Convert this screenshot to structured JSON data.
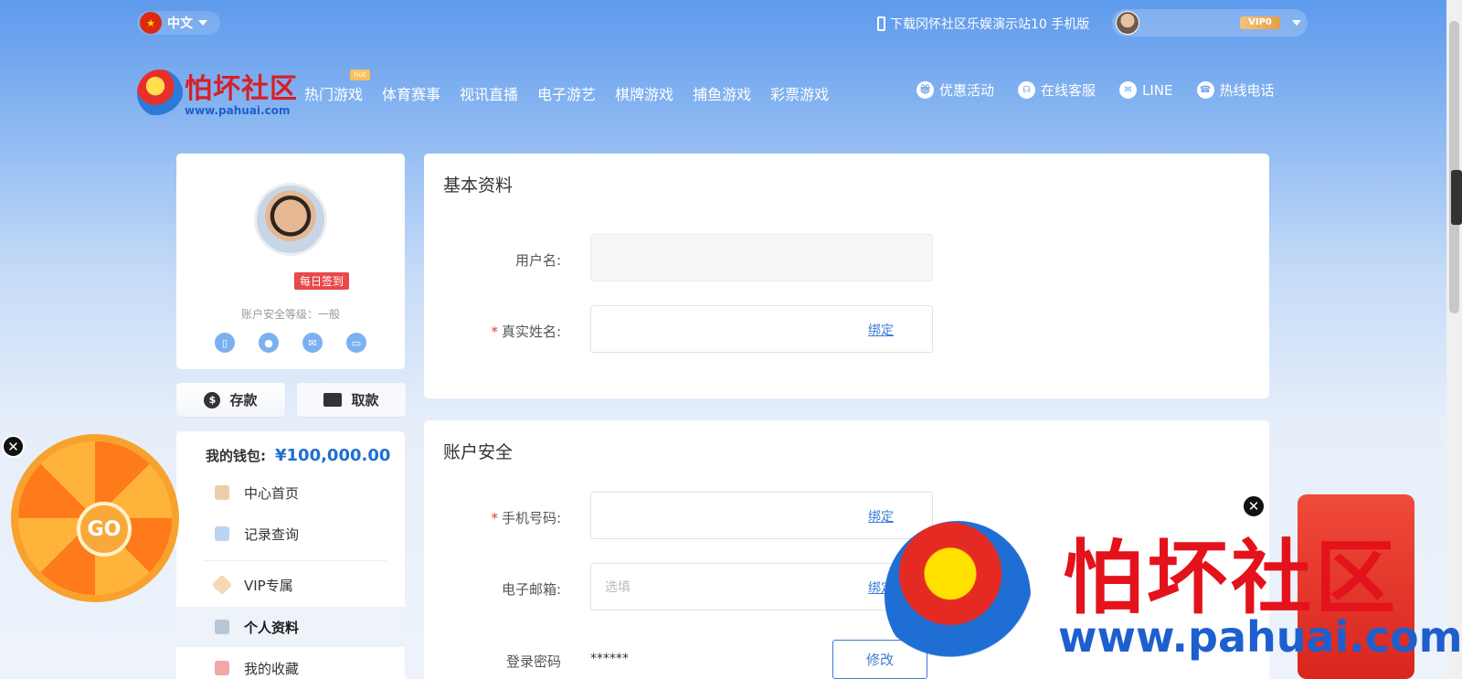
{
  "topbar": {
    "language": "中文",
    "download_text": "下载冈怀社区乐娱演示站10 手机版",
    "vip_badge": "VIP0"
  },
  "logo": {
    "name": "怕坏社区",
    "url": "www.pahuai.com"
  },
  "nav": {
    "hot_badge": "hot",
    "items": [
      "热门游戏",
      "体育赛事",
      "视讯直播",
      "电子游艺",
      "棋牌游戏",
      "捕鱼游戏",
      "彩票游戏"
    ],
    "right": [
      {
        "label": "优惠活动",
        "icon": "gift-icon"
      },
      {
        "label": "在线客服",
        "icon": "headset-icon"
      },
      {
        "label": "LINE",
        "icon": "line-icon"
      },
      {
        "label": "热线电话",
        "icon": "telephone-icon"
      }
    ]
  },
  "profile": {
    "checkin": "每日签到",
    "security_level": "账户安全等级：一般",
    "security_icons": [
      "mobile-icon",
      "user-icon",
      "mail-icon",
      "card-icon"
    ]
  },
  "actions": {
    "deposit": "存款",
    "withdraw": "取款"
  },
  "wallet": {
    "label": "我的钱包:",
    "amount": "¥100,000.00"
  },
  "menu": {
    "items": [
      {
        "label": "中心首页",
        "icon": "home-icon"
      },
      {
        "label": "记录查询",
        "icon": "record-icon"
      },
      {
        "label": "VIP专属",
        "icon": "vip-diamond-icon"
      },
      {
        "label": "个人资料",
        "icon": "profile-card-icon",
        "active": true
      },
      {
        "label": "我的收藏",
        "icon": "star-icon"
      }
    ]
  },
  "basic_info": {
    "title": "基本资料",
    "username_label": "用户名:",
    "realname_label": "真实姓名:",
    "bind": "绑定"
  },
  "account_security": {
    "title": "账户安全",
    "phone_label": "手机号码:",
    "email_label": "电子邮箱:",
    "email_placeholder": "选填",
    "password_label": "登录密码",
    "password_value": "******",
    "bind": "绑定",
    "modify": "修改"
  },
  "widgets": {
    "wheel_go": "GO",
    "close": "✕"
  },
  "watermark": {
    "text": "怕坏社区",
    "url": "www.pahuai.com"
  },
  "colors": {
    "accent": "#3a7bd5",
    "brand_red": "#e3121b",
    "required": "#ee3333"
  }
}
